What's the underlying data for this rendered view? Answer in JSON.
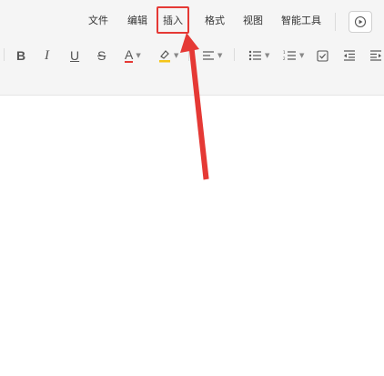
{
  "menu": {
    "file": "文件",
    "edit": "编辑",
    "insert": "插入",
    "format": "格式",
    "view": "视图",
    "smart_tools": "智能工具"
  },
  "toolbar": {
    "bold": "B",
    "italic": "I",
    "underline": "U",
    "strikethrough": "S",
    "font_color": "A"
  },
  "colors": {
    "highlight_red": "#e53935",
    "font_color_underline": "#e53935",
    "highlighter_yellow": "#f5c518"
  }
}
